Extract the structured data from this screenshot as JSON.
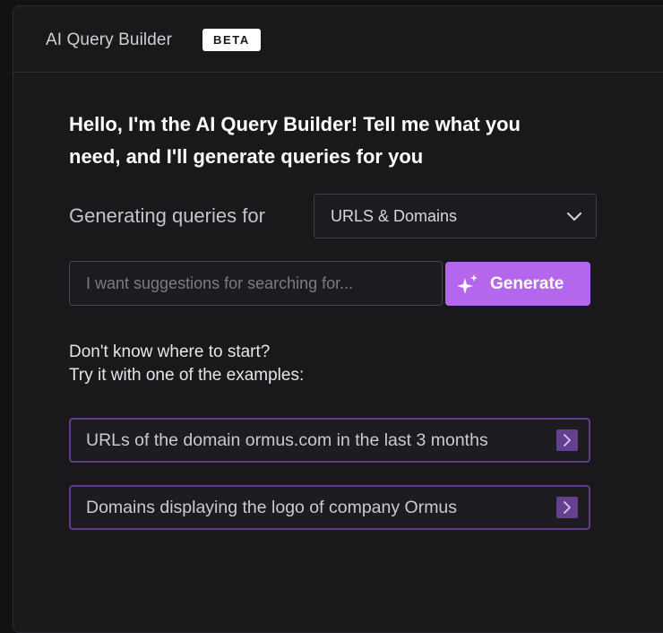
{
  "header": {
    "title": "AI Query Builder",
    "badge": "BETA"
  },
  "main": {
    "greeting_line1": "Hello, I'm the AI Query Builder! Tell me what you",
    "greeting_line2": "need, and I'll generate queries for you",
    "generating_label": "Generating queries for",
    "select": {
      "value": "URLS & Domains"
    },
    "query_input": {
      "value": "",
      "placeholder": "I want suggestions for searching for..."
    },
    "generate_label": "Generate",
    "hint_line1": "Don't know where to start?",
    "hint_line2": "Try it with one of the examples:",
    "examples": [
      {
        "label": "URLs of the domain ormus.com in the last 3 months"
      },
      {
        "label": "Domains displaying the logo of company Ormus"
      }
    ]
  },
  "colors": {
    "accent": "#b467ec",
    "example_border": "#5c3d86",
    "background": "#19191c"
  },
  "icons": {
    "select": "chevron-down-icon",
    "generate": "sparkle-icon",
    "example": "chevron-right-icon"
  }
}
